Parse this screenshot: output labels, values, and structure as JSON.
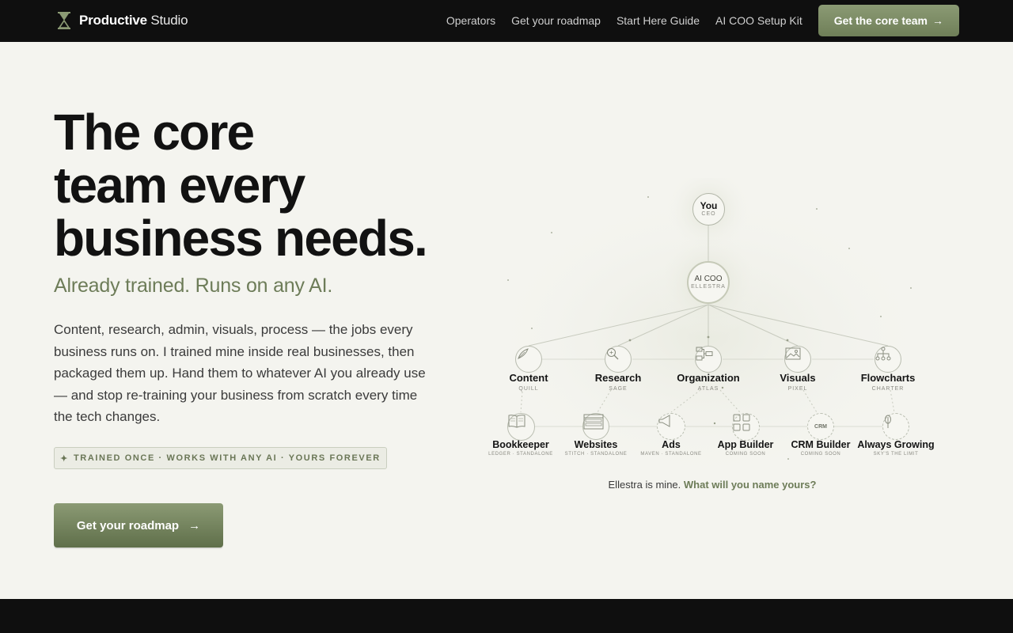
{
  "nav": {
    "brand_bold": "Productive",
    "brand_light": "Studio",
    "links": [
      "Operators",
      "Get your roadmap",
      "Start Here Guide",
      "AI COO Setup Kit"
    ],
    "cta_label": "Get the core team",
    "cta_arrow": "→"
  },
  "hero": {
    "title_lines": [
      "The core",
      "team every",
      "business needs."
    ],
    "subtitle": "Already trained. Runs on any AI.",
    "body": "Content, research, admin, visuals, process — the jobs every business runs on. I trained mine inside real businesses, then packaged them up. Hand them to whatever AI you already use — and stop re-training your business from scratch every time the tech changes.",
    "tag_star": "✦",
    "tag": "TRAINED ONCE · WORKS WITH ANY AI · YOURS FOREVER",
    "cta_label": "Get your roadmap",
    "cta_arrow": "→"
  },
  "chart": {
    "you": {
      "name": "You",
      "role": "CEO"
    },
    "coo": {
      "name": "AI COO",
      "role": "ELLESTRA"
    },
    "tier1": [
      {
        "name": "Content",
        "code": "QUILL",
        "icon": "quill-icon"
      },
      {
        "name": "Research",
        "code": "SAGE",
        "icon": "magnifier-icon"
      },
      {
        "name": "Organization",
        "code": "ATLAS",
        "icon": "org-icon"
      },
      {
        "name": "Visuals",
        "code": "PIXEL",
        "icon": "image-icon"
      },
      {
        "name": "Flowcharts",
        "code": "CHARTER",
        "icon": "flowchart-icon"
      }
    ],
    "tier2": [
      {
        "name": "Bookkeeper",
        "code": "LEDGER · STANDALONE",
        "icon": "book-icon"
      },
      {
        "name": "Websites",
        "code": "STITCH · STANDALONE",
        "icon": "browser-icon"
      },
      {
        "name": "Ads",
        "code": "MAVEN · STANDALONE",
        "icon": "megaphone-icon"
      },
      {
        "name": "App Builder",
        "code": "COMING SOON",
        "icon": "grid-icon"
      },
      {
        "name": "CRM Builder",
        "code": "COMING SOON",
        "icon": "crm-icon",
        "icon_text": "CRM"
      },
      {
        "name": "Always Growing",
        "code": "SKY'S THE LIMIT",
        "icon": "sprout-icon"
      }
    ],
    "caption_plain": "Ellestra is mine.",
    "caption_highlight": "What will you name yours?"
  },
  "colors": {
    "accent": "#6d7c58",
    "dark": "#0f0f0f",
    "background": "#f4f4ef"
  }
}
